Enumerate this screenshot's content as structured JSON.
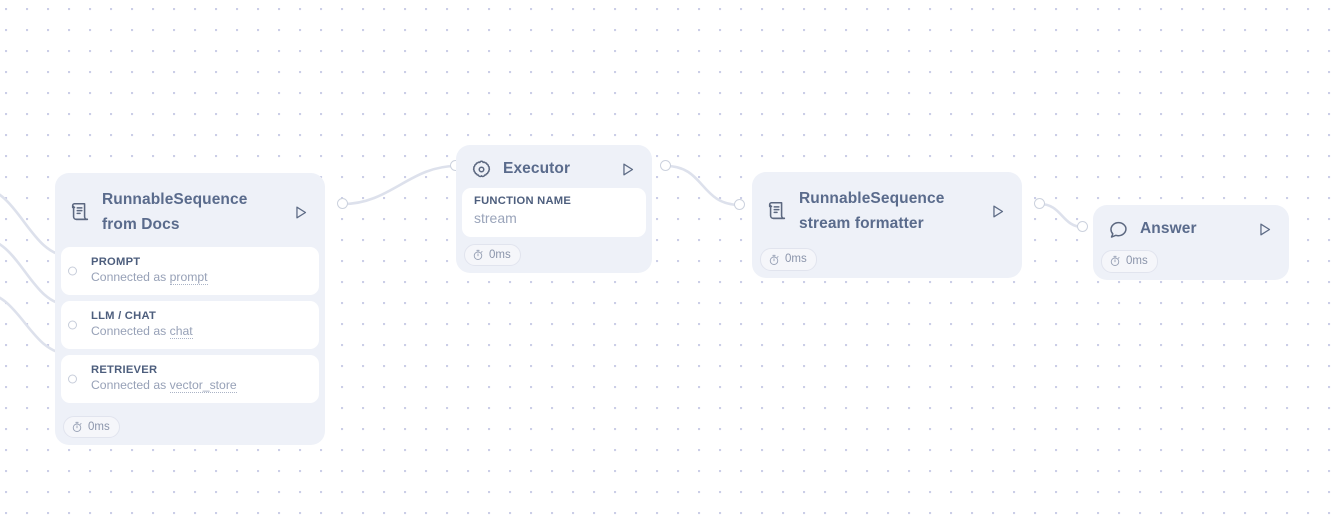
{
  "canvas": {
    "background_color": "#ffffff",
    "dot_color": "#c9cce6",
    "node_fill": "#eef1f8",
    "edge_color": "#dde1ec",
    "title_color": "#5a6b8c",
    "label_color": "#4d5e7d",
    "muted_color": "#97a1b7"
  },
  "nodes": [
    {
      "id": "runnable-sequence-from-docs",
      "icon": "scroll-icon",
      "title": "RunnableSequence\nfrom Docs",
      "run_label": "Run",
      "timing": "0ms",
      "rows": [
        {
          "title": "PROMPT",
          "sub_prefix": "Connected as ",
          "sub_value": "prompt"
        },
        {
          "title": "LLM / CHAT",
          "sub_prefix": "Connected as ",
          "sub_value": "chat"
        },
        {
          "title": "RETRIEVER",
          "sub_prefix": "Connected as ",
          "sub_value": "vector_store"
        }
      ]
    },
    {
      "id": "executor",
      "icon": "gear-icon",
      "title": "Executor",
      "run_label": "Run",
      "timing": "0ms",
      "field": {
        "label": "FUNCTION NAME",
        "value": "stream"
      }
    },
    {
      "id": "runnable-sequence-stream-formatter",
      "icon": "scroll-icon",
      "title": "RunnableSequence\nstream formatter",
      "run_label": "Run",
      "timing": "0ms"
    },
    {
      "id": "answer",
      "icon": "chat-bubble-icon",
      "title": "Answer",
      "run_label": "Run",
      "timing": "0ms"
    }
  ]
}
